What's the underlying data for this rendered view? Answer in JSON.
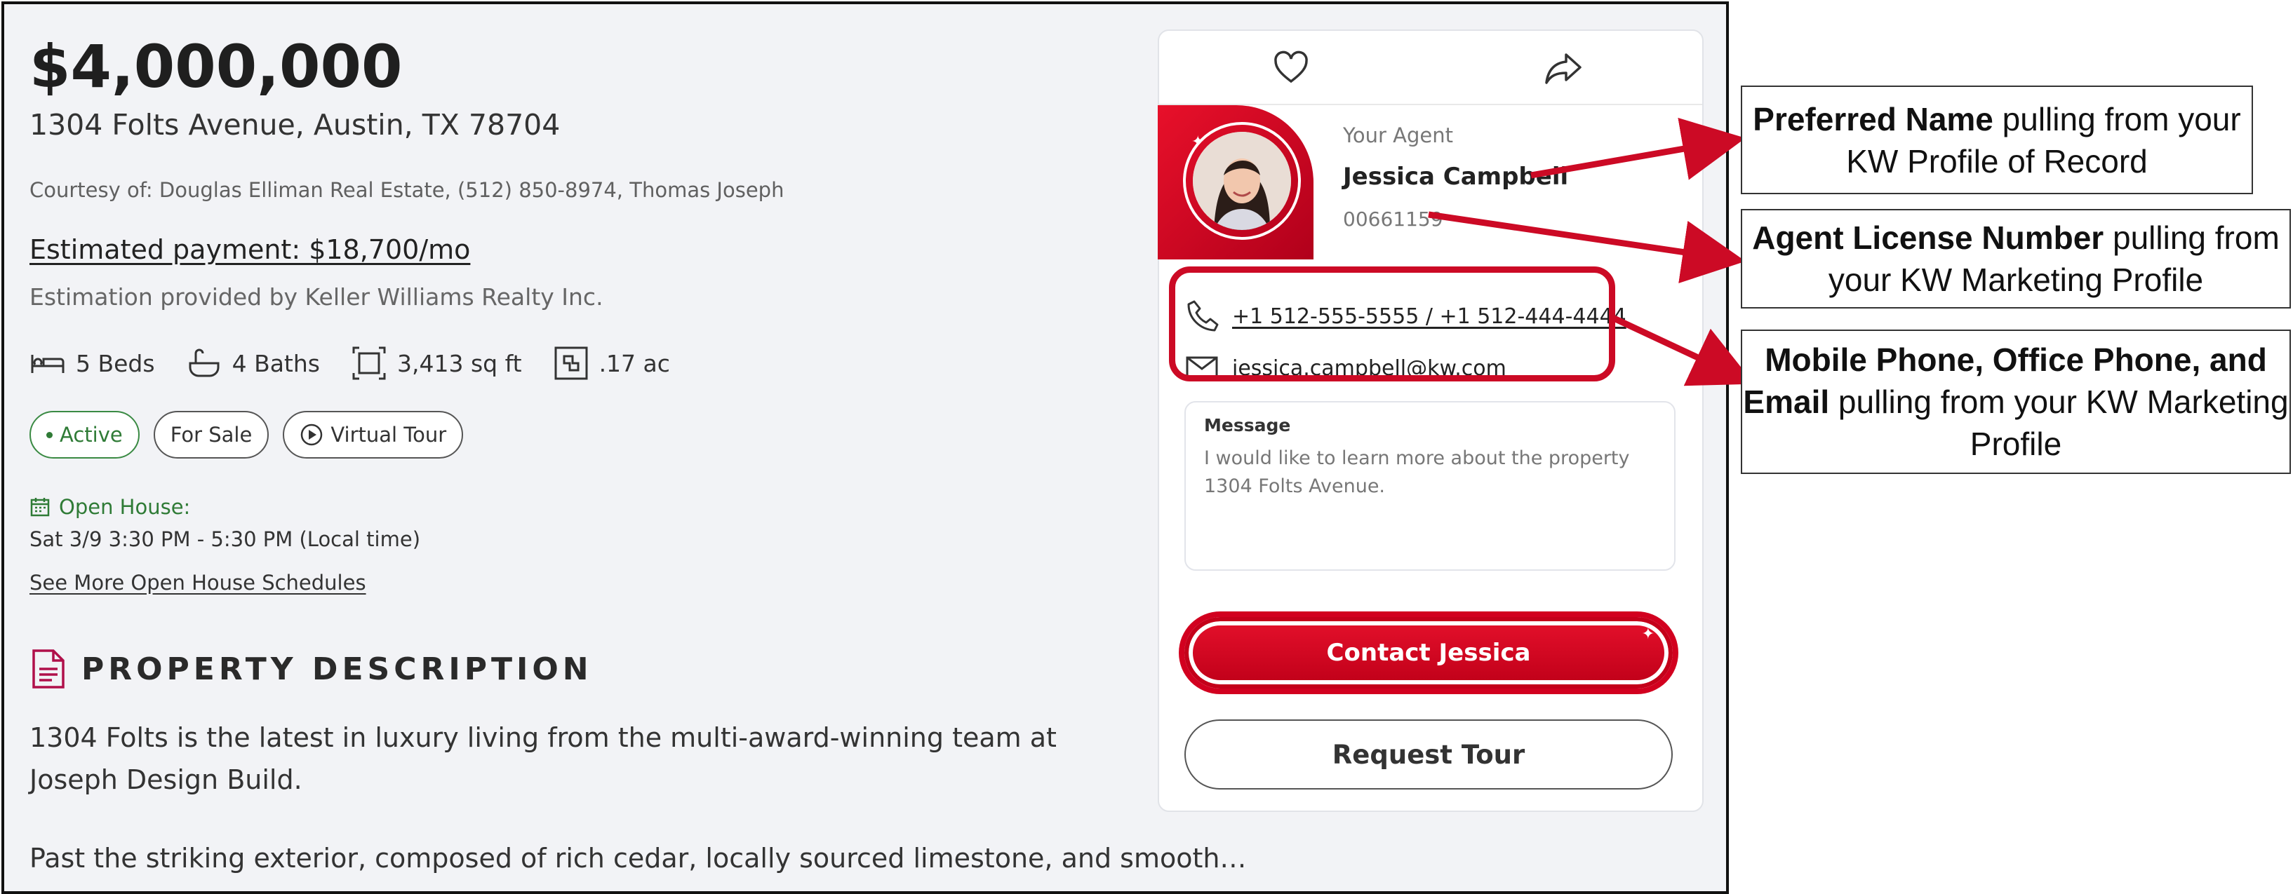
{
  "listing": {
    "price": "$4,000,000",
    "address": "1304 Folts Avenue, Austin, TX 78704",
    "courtesy": "Courtesy of: Douglas Elliman Real Estate, (512) 850-8974, Thomas Joseph",
    "estimated_payment": "Estimated payment: $18,700/mo",
    "estimation_note": "Estimation provided by Keller Williams Realty Inc.",
    "specs": {
      "beds": "5 Beds",
      "baths": "4 Baths",
      "sqft": "3,413 sq ft",
      "acres": ".17 ac"
    },
    "tags": {
      "active": "Active",
      "for_sale": "For Sale",
      "virtual_tour": "Virtual Tour"
    },
    "open_house": {
      "label": "Open House:",
      "time": "Sat 3/9 3:30 PM - 5:30 PM (Local time)",
      "more_link": "See More Open House Schedules"
    },
    "description": {
      "heading": "PROPERTY DESCRIPTION",
      "p1": "1304 Folts is the latest in luxury living from the multi-award-winning team at Joseph Design Build.",
      "p2": "Past the striking exterior, composed of rich cedar, locally sourced limestone, and smooth…"
    }
  },
  "agent_card": {
    "label": "Your Agent",
    "name": "Jessica Campbell",
    "license": "00661159",
    "phone": "+1 512-555-5555 / +1 512-444-4444",
    "email": "jessica.campbell@kw.com",
    "message_label": "Message",
    "message_text": "I would like to learn more about the property 1304 Folts Avenue.",
    "contact_button": "Contact Jessica",
    "tour_button": "Request Tour"
  },
  "callouts": {
    "c1_bold": "Preferred Name",
    "c1_rest": " pulling from your KW Profile of Record",
    "c2_bold": "Agent License Number",
    "c2_rest": " pulling from your KW Marketing Profile",
    "c3_bold": "Mobile Phone, Office Phone, and Email",
    "c3_rest": " pulling from your KW Marketing Profile"
  },
  "colors": {
    "brand_red": "#cc0a25",
    "active_green": "#2f7b36"
  }
}
